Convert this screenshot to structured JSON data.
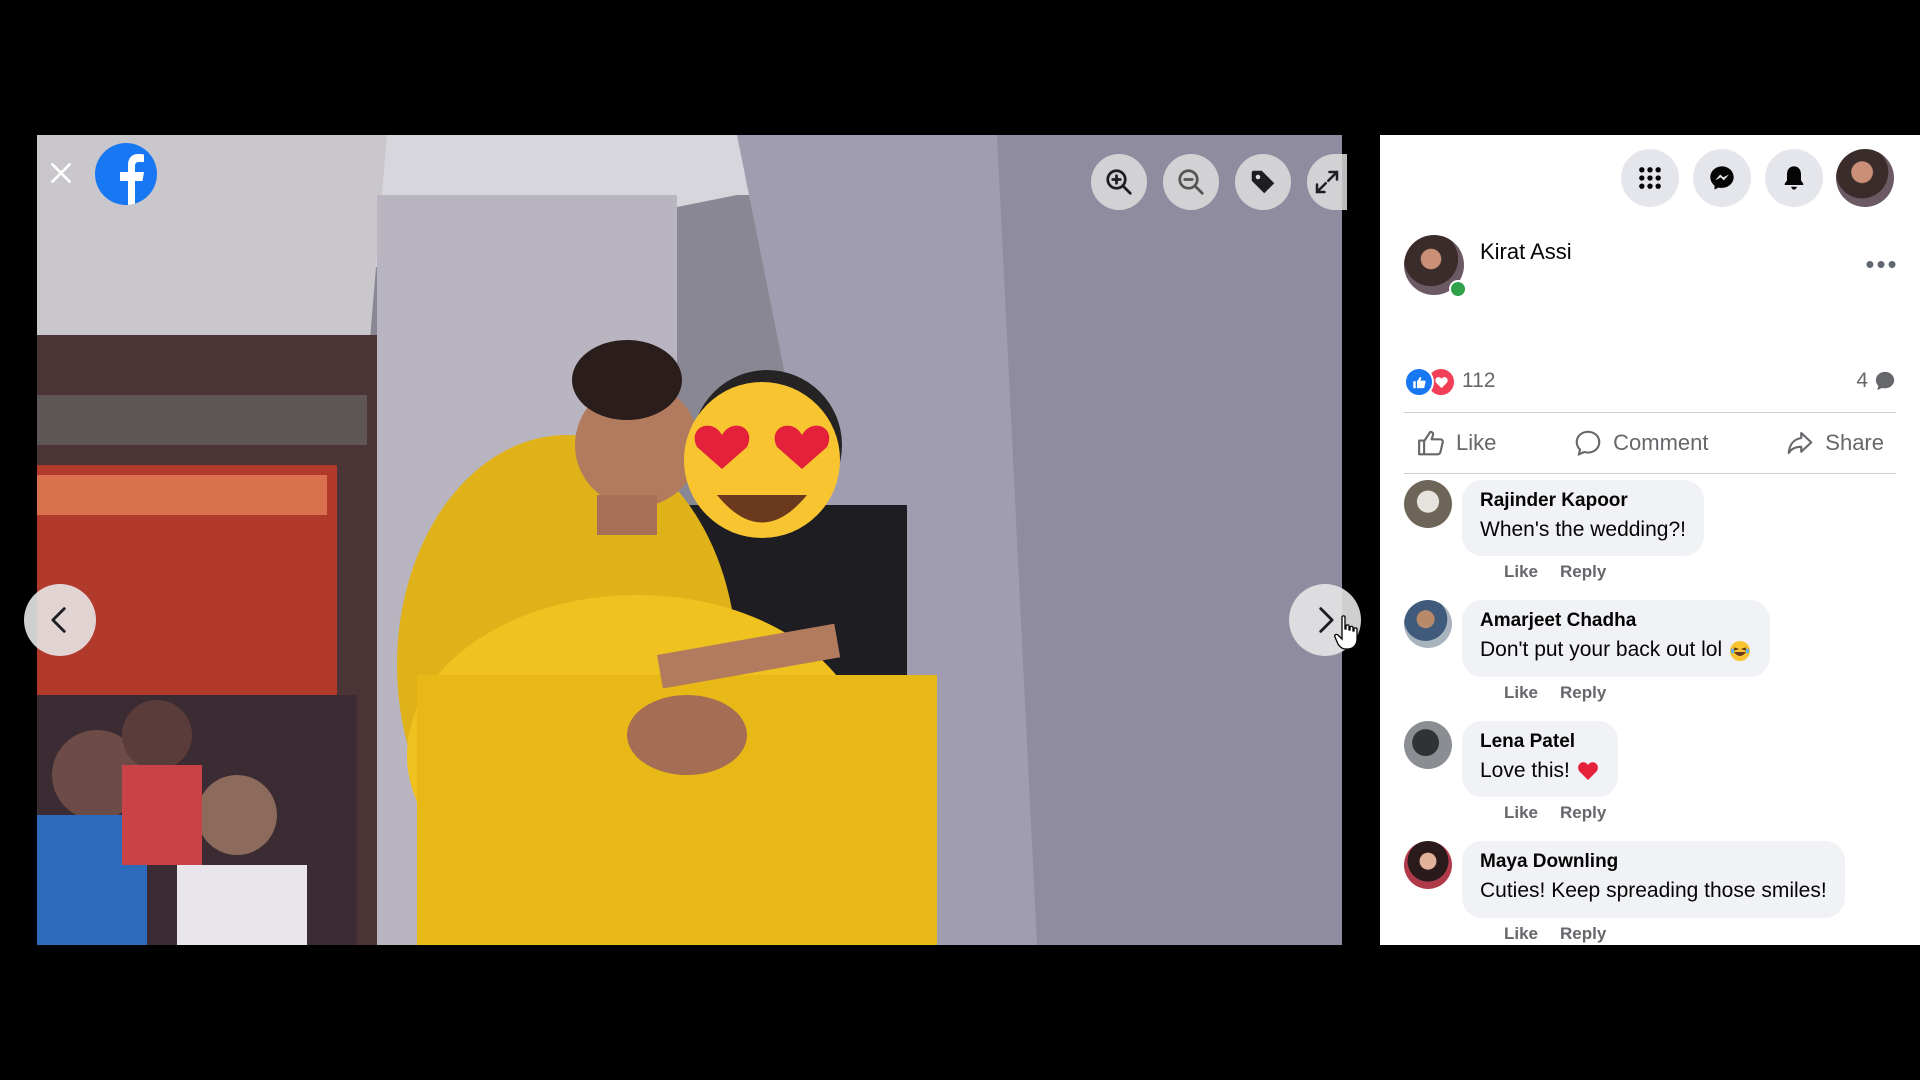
{
  "viewer": {
    "close_icon": "close-icon",
    "logo": "facebook-logo",
    "tools": [
      "zoom-in-icon",
      "zoom-out-icon",
      "tag-icon",
      "fullscreen-icon"
    ],
    "prev_icon": "chevron-left-icon",
    "next_icon": "chevron-right-icon"
  },
  "topbar": {
    "icons": [
      "menu-grid-icon",
      "messenger-icon",
      "notifications-bell-icon",
      "profile-avatar"
    ]
  },
  "post": {
    "author": "Kirat Assi",
    "more_label": "•••",
    "reaction_count": "112",
    "comment_count": "4",
    "actions": {
      "like": "Like",
      "comment": "Comment",
      "share": "Share"
    }
  },
  "comments": [
    {
      "name": "Rajinder Kapoor",
      "text": "When's the wedding?!",
      "emoji": "",
      "like": "Like",
      "reply": "Reply"
    },
    {
      "name": "Amarjeet Chadha",
      "text": "Don't put your back out lol",
      "emoji": "laughing-emoji",
      "like": "Like",
      "reply": "Reply"
    },
    {
      "name": "Lena Patel",
      "text": "Love this!",
      "emoji": "red-heart-emoji",
      "like": "Like",
      "reply": "Reply"
    },
    {
      "name": "Maya Downling",
      "text": "Cuties! Keep spreading those smiles!",
      "emoji": "",
      "like": "Like",
      "reply": "Reply"
    }
  ],
  "colors": {
    "fb_blue": "#1877f2",
    "love_red": "#f33e58",
    "online_green": "#31a24c",
    "muted_text": "#65676b",
    "bubble_bg": "#f0f2f5"
  }
}
